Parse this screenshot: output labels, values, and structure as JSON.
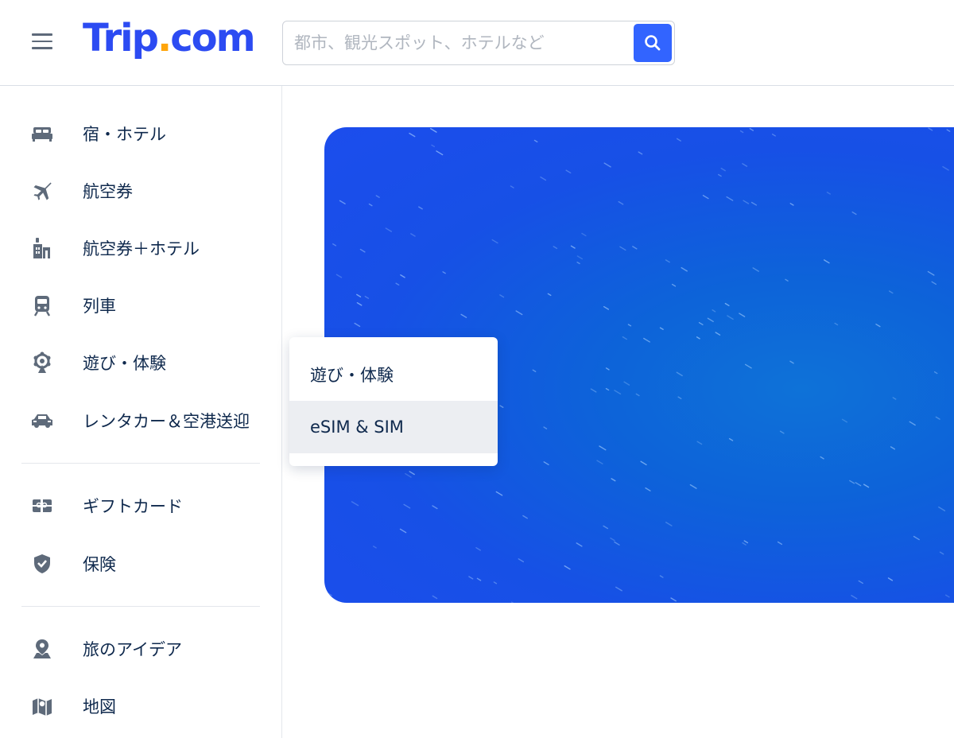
{
  "header": {
    "logo_main": "Trip",
    "logo_dot": ".",
    "logo_suffix": "com",
    "search_placeholder": "都市、観光スポット、ホテルなど"
  },
  "sidebar": {
    "items": [
      {
        "label": "宿・ホテル",
        "icon": "bed-icon"
      },
      {
        "label": "航空券",
        "icon": "airplane-icon"
      },
      {
        "label": "航空券＋ホテル",
        "icon": "flight-hotel-icon"
      },
      {
        "label": "列車",
        "icon": "train-icon"
      },
      {
        "label": "遊び・体験",
        "icon": "ferris-wheel-icon"
      },
      {
        "label": "レンタカー＆空港送迎",
        "icon": "car-icon"
      },
      {
        "label": "ギフトカード",
        "icon": "gift-card-icon"
      },
      {
        "label": "保険",
        "icon": "shield-icon"
      },
      {
        "label": "旅のアイデア",
        "icon": "map-pin-icon"
      },
      {
        "label": "地図",
        "icon": "map-icon"
      }
    ]
  },
  "dropdown": {
    "items": [
      {
        "label": "遊び・体験"
      },
      {
        "label": "eSIM & SIM"
      }
    ],
    "highlighted_index": 1
  },
  "colors": {
    "brand": "#2c4bf2",
    "logo_dot": "#ffa50a",
    "search_button": "#3264ff",
    "text": "#0f294d",
    "icon": "#5e6a7a"
  }
}
